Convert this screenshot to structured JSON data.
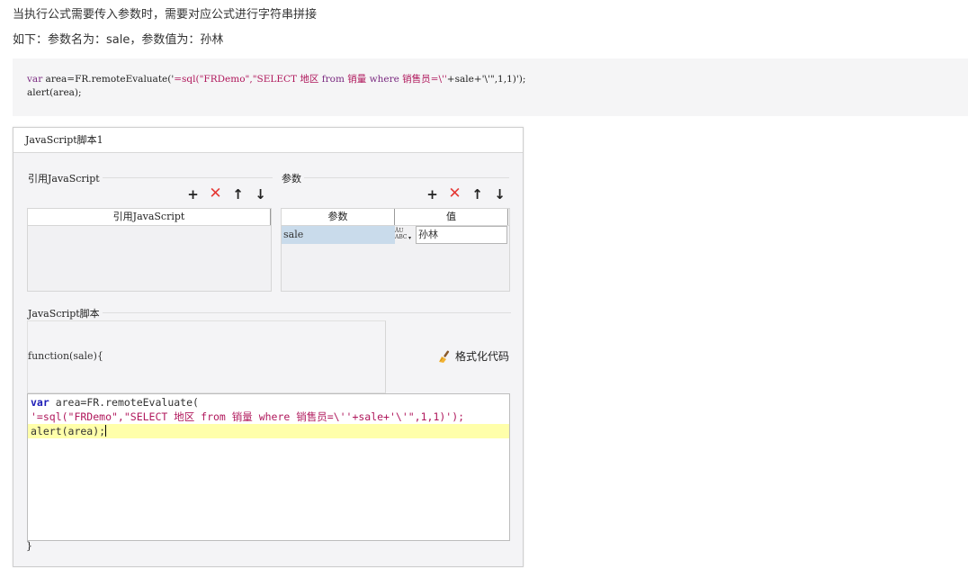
{
  "intro": {
    "line1": "当执行公式需要传入参数时，需要对应公式进行字符串拼接",
    "line2": "如下：参数名为：sale，参数值为：孙林"
  },
  "code_sample": {
    "l1_a": "var",
    "l1_b": " area=FR.remoteEvaluate('",
    "l1_c": "=sql(\"FRDemo\",\"SELECT 地区 ",
    "l1_d": "from",
    "l1_e": " 销量 ",
    "l1_f": "where",
    "l1_g": " 销售员=\\''",
    "l1_h": "+sale+'\\'\",1,1)');",
    "line2": "alert(area);"
  },
  "dialog": {
    "title": "JavaScript脚本1",
    "ref_section_label": "引用JavaScript",
    "ref_table_header": "引用JavaScript",
    "params_section_label": "参数",
    "params_header_name": "参数",
    "params_header_value": "值",
    "param_rows": [
      {
        "name": "sale",
        "value": "孙林"
      }
    ],
    "param_type_icon_text": "ÂU\nABC",
    "script_section_label": "JavaScript脚本",
    "function_signature": "function(sale){",
    "format_button_label": "格式化代码",
    "closing_brace": "}",
    "editor": {
      "l1_kw": "var",
      "l1_rest": " area=FR.remoteEvaluate(",
      "l2": "'=sql(\"FRDemo\",\"SELECT 地区 from 销量 where 销售员=\\''+sale+'\\'\",1,1)');",
      "l3": "alert(area);"
    }
  },
  "colors": {
    "accent_red": "#e53935",
    "selected_row": "#c9dbeb",
    "current_line": "#ffffaa"
  }
}
